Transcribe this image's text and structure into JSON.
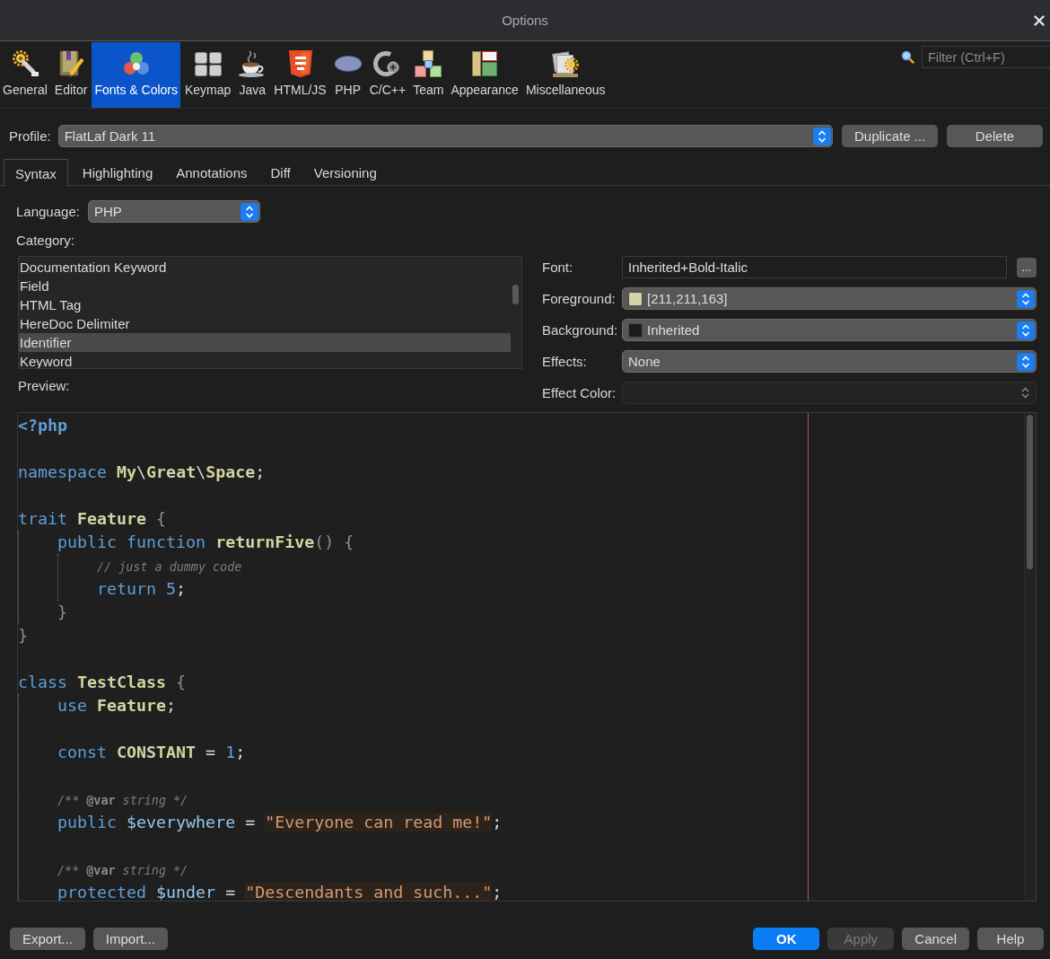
{
  "window": {
    "title": "Options"
  },
  "toolbar": {
    "items": [
      {
        "label": "General",
        "selected": false
      },
      {
        "label": "Editor",
        "selected": false
      },
      {
        "label": "Fonts & Colors",
        "selected": true
      },
      {
        "label": "Keymap",
        "selected": false
      },
      {
        "label": "Java",
        "selected": false
      },
      {
        "label": "HTML/JS",
        "selected": false
      },
      {
        "label": "PHP",
        "selected": false
      },
      {
        "label": "C/C++",
        "selected": false
      },
      {
        "label": "Team",
        "selected": false
      },
      {
        "label": "Appearance",
        "selected": false
      },
      {
        "label": "Miscellaneous",
        "selected": false
      }
    ],
    "filter": {
      "placeholder": "Filter (Ctrl+F)"
    }
  },
  "profile": {
    "label": "Profile:",
    "value": "FlatLaf Dark 11",
    "buttons": [
      "Duplicate ...",
      "Delete"
    ]
  },
  "tabs": [
    {
      "label": "Syntax",
      "selected": true
    },
    {
      "label": "Highlighting",
      "selected": false
    },
    {
      "label": "Annotations",
      "selected": false
    },
    {
      "label": "Diff",
      "selected": false
    },
    {
      "label": "Versioning",
      "selected": false
    }
  ],
  "language": {
    "label": "Language:",
    "value": "PHP"
  },
  "category": {
    "label": "Category:",
    "items": [
      {
        "label": "Documentation Keyword",
        "selected": false
      },
      {
        "label": "Field",
        "selected": false
      },
      {
        "label": "HTML Tag",
        "selected": false
      },
      {
        "label": "HereDoc Delimiter",
        "selected": false
      },
      {
        "label": "Identifier",
        "selected": true
      },
      {
        "label": "Keyword",
        "selected": false
      }
    ]
  },
  "properties": [
    {
      "label": "Font:",
      "kind": "text",
      "value": "Inherited+Bold-Italic",
      "button": "...",
      "disabled": false
    },
    {
      "label": "Foreground:",
      "kind": "combo",
      "value": "[211,211,163]",
      "color": "#d3d3a3",
      "disabled": false
    },
    {
      "label": "Background:",
      "kind": "combo",
      "value": "Inherited",
      "color": "#1c1c1c",
      "disabled": false
    },
    {
      "label": "Effects:",
      "kind": "combo",
      "value": "None",
      "disabled": false
    },
    {
      "label": "Effect Color:",
      "kind": "combo",
      "disabled": true
    }
  ],
  "preview": {
    "label": "Preview:",
    "lines": [
      {
        "kind": "code",
        "tokens": [
          {
            "kind": "php_tag",
            "text": "<?php"
          }
        ]
      },
      {
        "kind": "blank"
      },
      {
        "kind": "code",
        "tokens": [
          {
            "kind": "keyword",
            "text": "namespace"
          },
          {
            "kind": "type",
            "text": " My"
          },
          {
            "kind": "plain",
            "text": "\\"
          },
          {
            "kind": "type",
            "text": "Great"
          },
          {
            "kind": "plain",
            "text": "\\"
          },
          {
            "kind": "type",
            "text": "Space"
          },
          {
            "kind": "plain",
            "text": ";"
          }
        ]
      },
      {
        "kind": "blank"
      },
      {
        "kind": "code",
        "tokens": [
          {
            "kind": "keyword",
            "text": "trait"
          },
          {
            "kind": "type",
            "text": " Feature"
          },
          {
            "kind": "brace",
            "text": " {"
          }
        ],
        "children": [
          {
            "kind": "code",
            "tokens": [
              {
                "kind": "keyword",
                "text": "public"
              },
              {
                "kind": "keyword",
                "text": " function"
              },
              {
                "kind": "type",
                "text": " returnFive"
              },
              {
                "kind": "brace",
                "text": "()"
              },
              {
                "kind": "brace",
                "text": " {"
              }
            ],
            "children": [
              {
                "kind": "code",
                "tokens": [
                  {
                    "kind": "comment",
                    "text": "// just a dummy code"
                  }
                ]
              },
              {
                "kind": "code",
                "tokens": [
                  {
                    "kind": "keyword",
                    "text": "return"
                  },
                  {
                    "kind": "number",
                    "text": " 5"
                  },
                  {
                    "kind": "plain",
                    "text": ";"
                  }
                ]
              }
            ]
          },
          {
            "kind": "code",
            "tokens": [
              {
                "kind": "brace",
                "text": "}"
              }
            ]
          }
        ]
      },
      {
        "kind": "code",
        "tokens": [
          {
            "kind": "brace",
            "text": "}"
          }
        ]
      },
      {
        "kind": "blank"
      },
      {
        "kind": "code",
        "tokens": [
          {
            "kind": "keyword",
            "text": "class"
          },
          {
            "kind": "type",
            "text": " TestClass"
          },
          {
            "kind": "brace",
            "text": " {"
          }
        ],
        "children": [
          {
            "kind": "code",
            "tokens": [
              {
                "kind": "keyword",
                "text": "use"
              },
              {
                "kind": "type",
                "text": " Feature"
              },
              {
                "kind": "plain",
                "text": ";"
              }
            ]
          },
          {
            "kind": "blank"
          },
          {
            "kind": "code",
            "tokens": [
              {
                "kind": "keyword",
                "text": "const"
              },
              {
                "kind": "type",
                "text": " CONSTANT"
              },
              {
                "kind": "plain",
                "text": " = "
              },
              {
                "kind": "number",
                "text": "1"
              },
              {
                "kind": "plain",
                "text": ";"
              }
            ]
          },
          {
            "kind": "blank"
          },
          {
            "kind": "code",
            "tokens": [
              {
                "kind": "comment",
                "text": "/** "
              },
              {
                "kind": "doctag",
                "text": "@var"
              },
              {
                "kind": "comment",
                "text": " string */"
              }
            ]
          },
          {
            "kind": "code",
            "tokens": [
              {
                "kind": "keyword",
                "text": "public"
              },
              {
                "kind": "variable",
                "text": " $everywhere"
              },
              {
                "kind": "plain",
                "text": " = "
              },
              {
                "kind": "string",
                "text": "\"Everyone can read me!\""
              },
              {
                "kind": "plain",
                "text": ";"
              }
            ]
          },
          {
            "kind": "blank"
          },
          {
            "kind": "code",
            "tokens": [
              {
                "kind": "comment",
                "text": "/** "
              },
              {
                "kind": "doctag",
                "text": "@var"
              },
              {
                "kind": "comment",
                "text": " string */"
              }
            ]
          },
          {
            "kind": "code",
            "tokens": [
              {
                "kind": "keyword",
                "text": "protected"
              },
              {
                "kind": "variable",
                "text": " $under"
              },
              {
                "kind": "plain",
                "text": " = "
              },
              {
                "kind": "string",
                "text": "\"Descendants and such...\""
              },
              {
                "kind": "plain",
                "text": ";"
              }
            ]
          }
        ]
      }
    ]
  },
  "buttons": {
    "left": [
      "Export...",
      "Import..."
    ],
    "right": [
      {
        "label": "OK",
        "default": true,
        "disabled": false
      },
      {
        "label": "Apply",
        "default": false,
        "disabled": true
      },
      {
        "label": "Cancel",
        "default": false,
        "disabled": false
      },
      {
        "label": "Help",
        "default": false,
        "disabled": false
      }
    ]
  }
}
